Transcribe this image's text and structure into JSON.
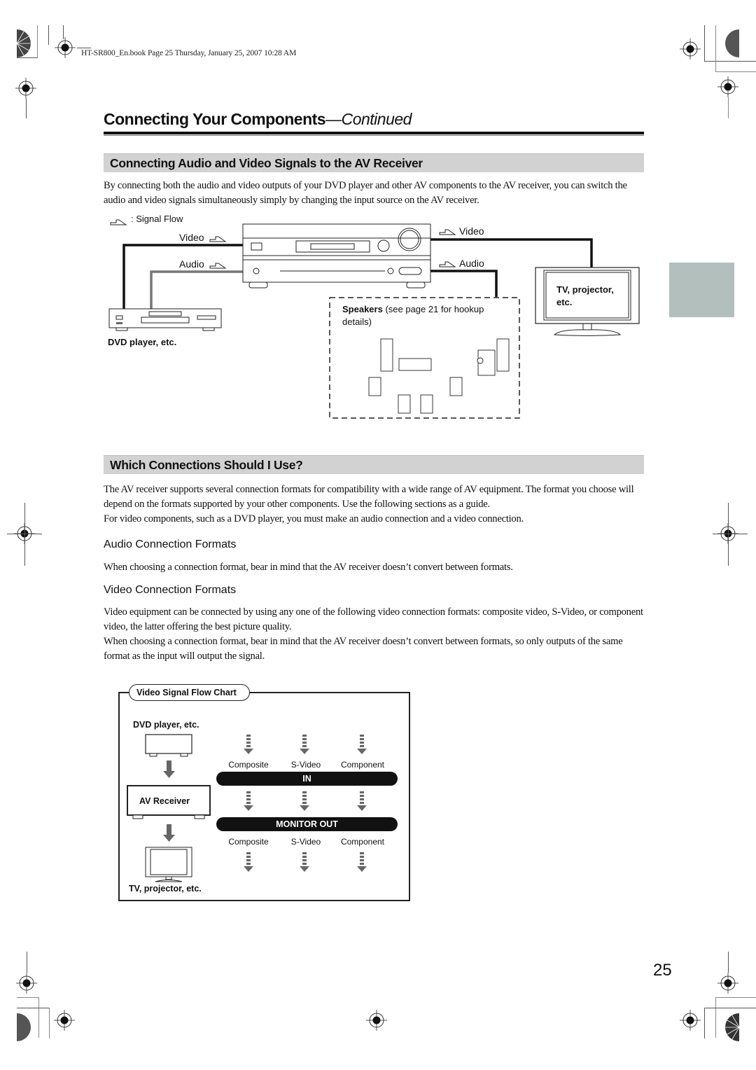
{
  "print_header": {
    "book_line": "HT-SR800_En.book  Page 25  Thursday, January 25, 2007   10:28 AM"
  },
  "page": {
    "title_main": "Connecting Your Components",
    "title_suffix": "—Continued",
    "page_number": "25"
  },
  "section1": {
    "heading": "Connecting Audio and Video Signals to the AV Receiver",
    "paragraph": "By connecting both the audio and video outputs of your DVD player and other AV components to the AV receiver, you can switch the audio and video signals simultaneously simply by changing the input source on the AV receiver.",
    "diagram": {
      "legend": ": Signal Flow",
      "video_in_label": "Video",
      "audio_in_label": "Audio",
      "video_out_label": "Video",
      "audio_out_label": "Audio",
      "source_label": "DVD player, etc.",
      "display_label": "TV, projector, etc.",
      "speakers_bold": "Speakers",
      "speakers_note": " (see page 21 for hookup details)"
    }
  },
  "section2": {
    "heading": "Which Connections Should I Use?",
    "paragraph1": "The AV receiver supports several connection formats for compatibility with a wide range of AV equipment. The format you choose will depend on the formats supported by your other components. Use the following sections as a guide.",
    "paragraph2": "For video components, such as a DVD player, you must make an audio connection and a video connection.",
    "audio_formats": {
      "heading": "Audio Connection Formats",
      "text": "When choosing a connection format, bear in mind that the AV receiver doesn’t convert between formats."
    },
    "video_formats": {
      "heading": "Video Connection Formats",
      "text1": "Video equipment can be connected by using any one of the following video connection formats: composite video, S-Video, or component video, the latter offering the best picture quality.",
      "text2": "When choosing a connection format, bear in mind that the AV receiver doesn’t convert between formats, so only outputs of the same format as the input will output the signal."
    }
  },
  "flow_chart": {
    "title": "Video Signal Flow Chart",
    "source": "DVD player, etc.",
    "receiver": "AV Receiver",
    "display": "TV, projector, etc.",
    "in_label": "IN",
    "out_label": "MONITOR OUT",
    "in_formats": [
      "Composite",
      "S-Video",
      "Component"
    ],
    "out_formats": [
      "Composite",
      "S-Video",
      "Component"
    ]
  }
}
